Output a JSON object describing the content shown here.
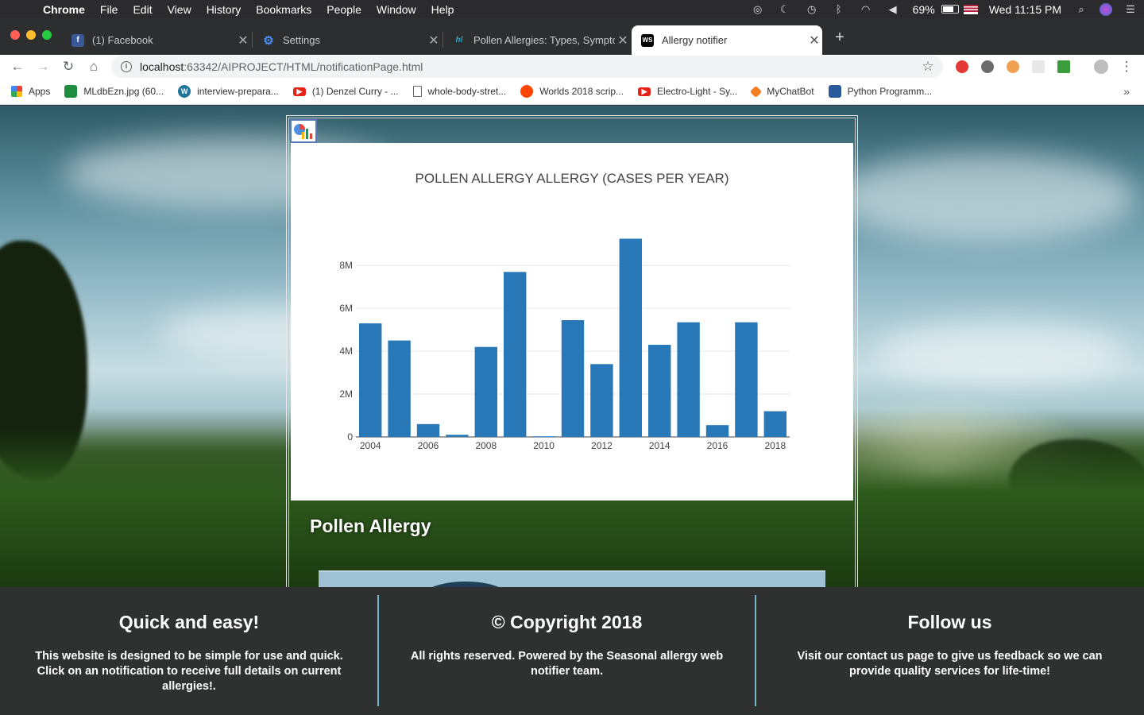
{
  "menubar": {
    "app": "Chrome",
    "items": [
      "File",
      "Edit",
      "View",
      "History",
      "Bookmarks",
      "People",
      "Window",
      "Help"
    ],
    "battery": "69%",
    "clock": "Wed 11:15 PM"
  },
  "tabs": [
    {
      "title": "(1) Facebook",
      "icon": "facebook-icon",
      "color": "#3b5998",
      "glyph": "f"
    },
    {
      "title": "Settings",
      "icon": "gear-icon",
      "color": "#1a73e8",
      "glyph": "⚙"
    },
    {
      "title": "Pollen Allergies: Types, Sympto",
      "icon": "healthline-icon",
      "color": "#2aa7c7",
      "glyph": "hl"
    },
    {
      "title": "Allergy notifier",
      "icon": "webstorm-icon",
      "color": "#000000",
      "glyph": "WS"
    }
  ],
  "toolbar": {
    "url_host": "localhost",
    "url_path": ":63342/AIPROJECT/HTML/notificationPage.html"
  },
  "bookmarks": [
    {
      "label": "Apps",
      "icon": "apps-grid-icon",
      "color": "#e8453c"
    },
    {
      "label": "MLdbEzn.jpg (60...",
      "icon": "image-icon",
      "color": "#1e8e3e"
    },
    {
      "label": "interview-prepara...",
      "icon": "wordpress-icon",
      "color": "#21759b"
    },
    {
      "label": "(1) Denzel Curry - ...",
      "icon": "youtube-icon",
      "color": "#e62117"
    },
    {
      "label": "whole-body-stret...",
      "icon": "document-icon",
      "color": "#ffffff"
    },
    {
      "label": "Worlds 2018 scrip...",
      "icon": "reddit-icon",
      "color": "#ff4500"
    },
    {
      "label": "Electro-Light - Sy...",
      "icon": "youtube-icon",
      "color": "#e62117"
    },
    {
      "label": "MyChatBot",
      "icon": "chatbot-icon",
      "color": "#f48024"
    },
    {
      "label": "Python Programm...",
      "icon": "python-site-icon",
      "color": "#2a5a9c"
    }
  ],
  "chart_data": {
    "type": "bar",
    "title": "POLLEN ALLERGY ALLERGY (CASES PER YEAR)",
    "categories": [
      2004,
      2005,
      2006,
      2007,
      2008,
      2009,
      2010,
      2011,
      2012,
      2013,
      2014,
      2015,
      2016,
      2017,
      2018
    ],
    "values": [
      5300000,
      4500000,
      600000,
      100000,
      4200000,
      7700000,
      30000,
      5450000,
      3400000,
      9250000,
      4300000,
      5350000,
      550000,
      5350000,
      1200000
    ],
    "x_tick_labels": [
      "2004",
      "2006",
      "2008",
      "2010",
      "2012",
      "2014",
      "2016",
      "2018"
    ],
    "y_tick_labels": [
      "0",
      "2M",
      "4M",
      "6M",
      "8M"
    ],
    "y_ticks": [
      0,
      2000000,
      4000000,
      6000000,
      8000000
    ],
    "ylim": [
      0,
      9750000
    ],
    "xlabel": "",
    "ylabel": "",
    "bar_color": "#2878b8",
    "grid": true
  },
  "content": {
    "section_title": "Pollen Allergy"
  },
  "footer": [
    {
      "title": "Quick and easy!",
      "text": "This website is designed to be simple for use and quick. Click on an notification to receive full details on current allergies!."
    },
    {
      "title": "© Copyright 2018",
      "text": "All rights reserved. Powered by the Seasonal allergy web notifier team."
    },
    {
      "title": "Follow us",
      "text": "Visit our contact us page to give us feedback so we can provide quality services for life-time!"
    }
  ]
}
